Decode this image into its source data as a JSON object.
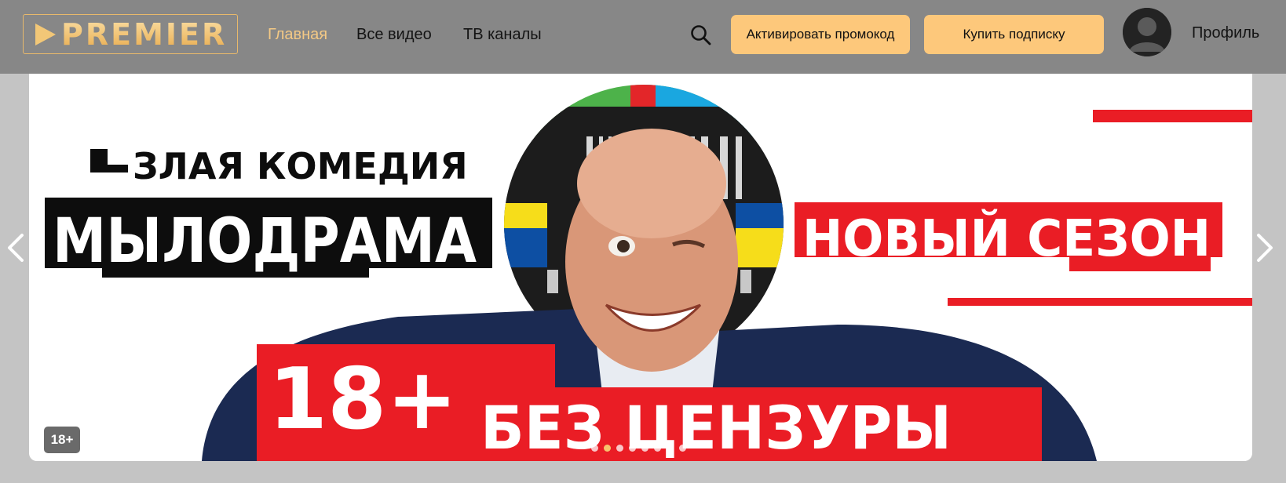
{
  "header": {
    "logo_text": "PREMIER",
    "nav": [
      {
        "label": "Главная",
        "active": true
      },
      {
        "label": "Все видео",
        "active": false
      },
      {
        "label": "ТВ каналы",
        "active": false
      }
    ],
    "search_icon": "search-icon",
    "promo_button": "Активировать промокод",
    "buy_button": "Купить подписку",
    "profile_label": "Профиль"
  },
  "banner": {
    "kicker": "ЗЛАЯ КОМЕДИЯ",
    "title": "МЫЛОДРАМА",
    "new_season": "НОВЫЙ СЕЗОН",
    "age_big": "18+",
    "uncensored": "БЕЗ ЦЕНЗУРЫ",
    "age_badge": "18+",
    "slides_count": 8,
    "active_slide": 1
  },
  "colors": {
    "header_bg": "#878787",
    "accent": "#fdc87b",
    "active_nav": "#f4c985",
    "banner_red": "#ea1d25"
  }
}
